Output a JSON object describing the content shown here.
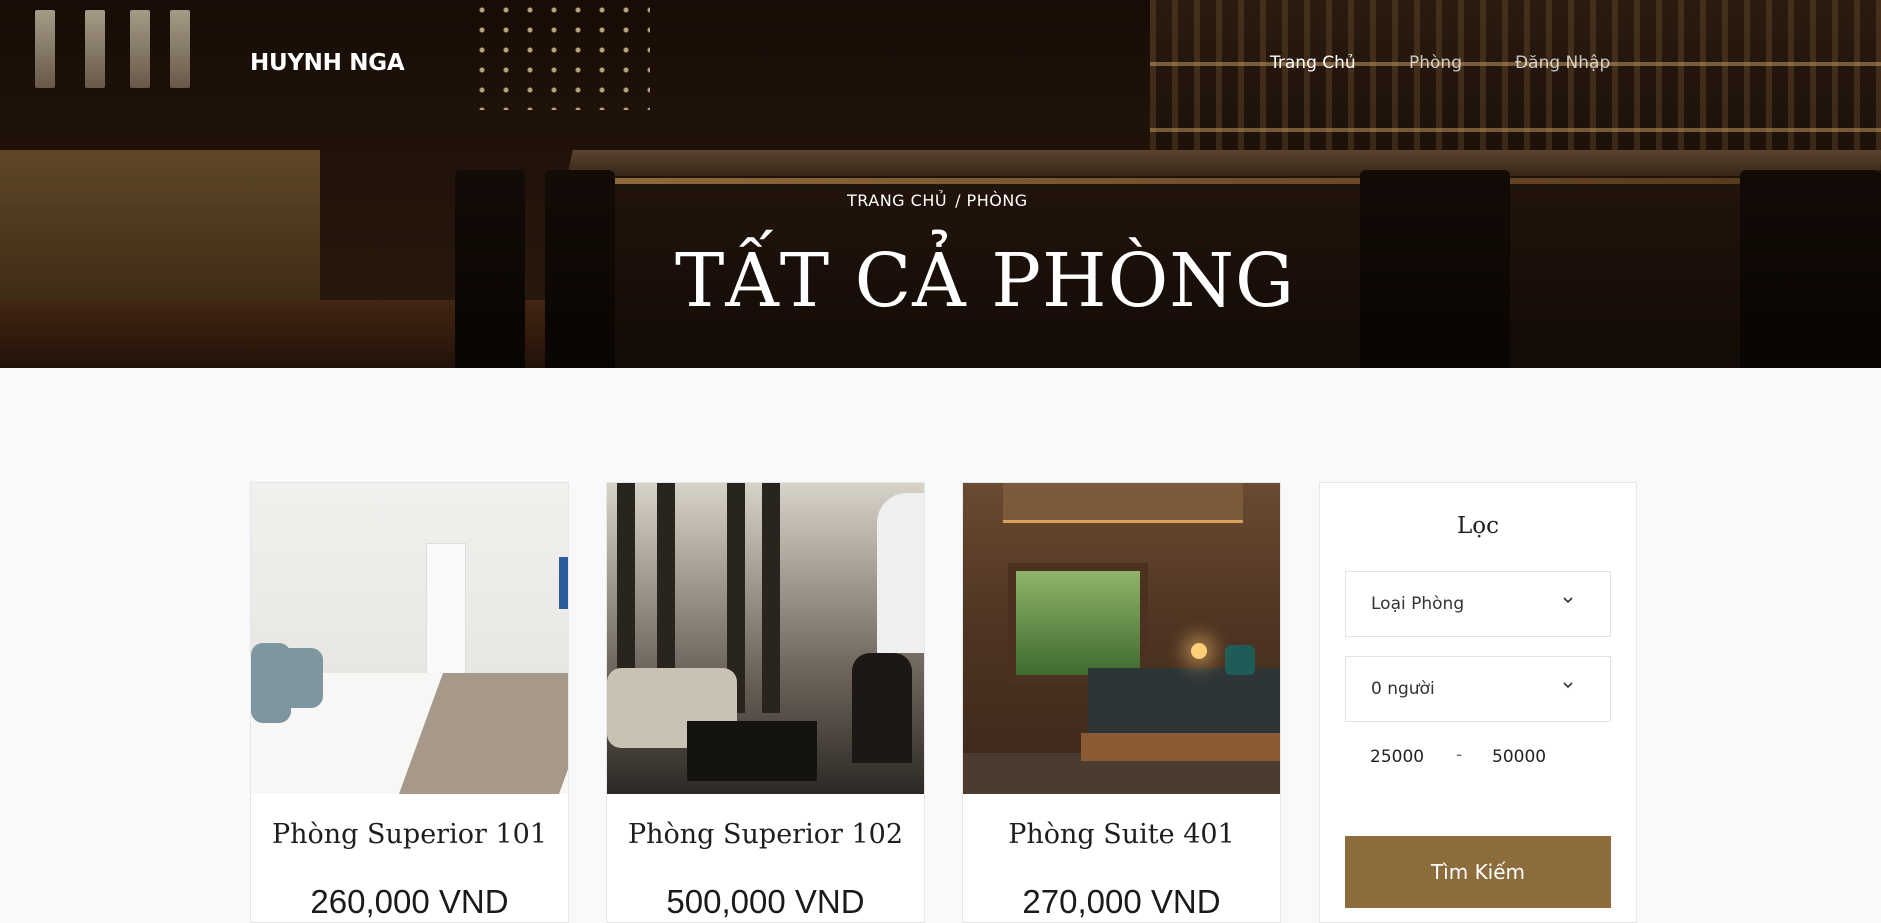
{
  "header": {
    "brand": "HUYNH NGA",
    "nav": [
      {
        "label": "Trang Chủ",
        "active": true
      },
      {
        "label": "Phòng",
        "active": false
      },
      {
        "label": "Đăng Nhập",
        "active": false
      }
    ],
    "breadcrumb": [
      "TRANG CHỦ",
      "/ PHÒNG"
    ],
    "title": "TẤT CẢ PHÒNG"
  },
  "rooms": [
    {
      "name": "Phòng Superior 101",
      "price": "260,000 VND"
    },
    {
      "name": "Phòng Superior 102",
      "price": "500,000 VND"
    },
    {
      "name": "Phòng Suite 401",
      "price": "270,000 VND"
    }
  ],
  "filter": {
    "title": "Lọc",
    "room_type": "Loại Phòng",
    "guests": "0 người",
    "price_min": "25000",
    "price_separator": "-",
    "price_max": "50000",
    "search_label": "Tìm Kiếm"
  },
  "colors": {
    "accent": "#8b6c3a",
    "background": "#f8f9fb"
  }
}
